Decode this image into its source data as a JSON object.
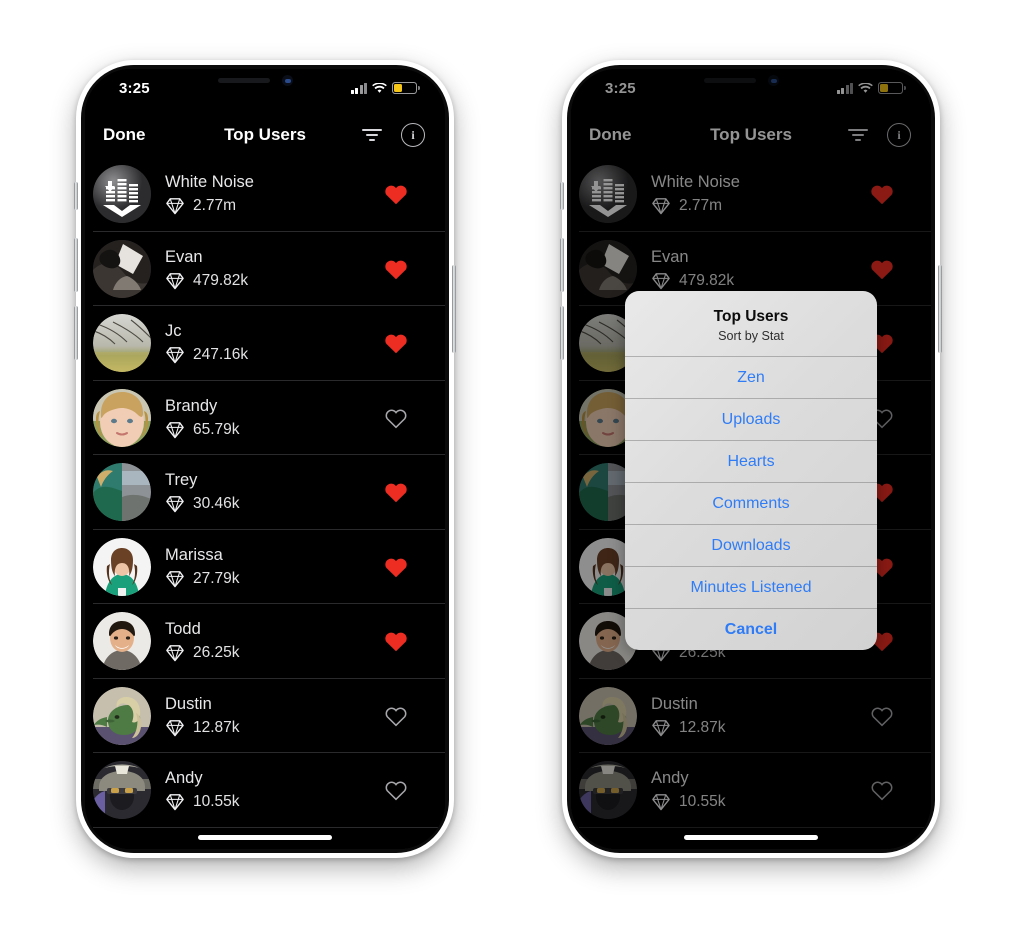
{
  "screens": [
    {
      "id": "list-screen",
      "status_bar": {
        "time": "3:25",
        "signal_icon": "cellular-signal-icon",
        "wifi_icon": "wifi-icon",
        "battery_icon": "battery-low-power-icon"
      },
      "nav": {
        "back_label": "Done",
        "title": "Top Users",
        "filter_icon": "sort-filter-icon",
        "info_icon": "info-circle-icon",
        "info_glyph": "i"
      },
      "sheet_visible": false
    },
    {
      "id": "sort-sheet-screen",
      "status_bar": {
        "time": "3:25",
        "signal_icon": "cellular-signal-icon",
        "wifi_icon": "wifi-icon",
        "battery_icon": "battery-low-power-icon"
      },
      "nav": {
        "back_label": "Done",
        "title": "Top Users",
        "filter_icon": "sort-filter-icon",
        "info_icon": "info-circle-icon",
        "info_glyph": "i"
      },
      "sheet_visible": true
    }
  ],
  "action_sheet": {
    "title": "Top Users",
    "subtitle": "Sort by Stat",
    "options": [
      {
        "label": "Zen"
      },
      {
        "label": "Uploads"
      },
      {
        "label": "Hearts"
      },
      {
        "label": "Comments"
      },
      {
        "label": "Downloads"
      },
      {
        "label": "Minutes Listened"
      }
    ],
    "cancel_label": "Cancel",
    "tint_color": "#2f7cf6"
  },
  "list": {
    "stat_icon": "gem-icon",
    "hearted_color": "#ee2d22",
    "unhearted_color": "#a8a8ac",
    "rows": [
      {
        "name": "White Noise",
        "value": "2.77m",
        "hearted": true,
        "avatar": "equalizer-logo-avatar"
      },
      {
        "name": "Evan",
        "value": "479.82k",
        "hearted": true,
        "avatar": "photo-avatar-evan"
      },
      {
        "name": "Jc",
        "value": "247.16k",
        "hearted": true,
        "avatar": "photo-avatar-jc"
      },
      {
        "name": "Brandy",
        "value": "65.79k",
        "hearted": false,
        "avatar": "photo-avatar-brandy"
      },
      {
        "name": "Trey",
        "value": "30.46k",
        "hearted": true,
        "avatar": "photo-avatar-trey"
      },
      {
        "name": "Marissa",
        "value": "27.79k",
        "hearted": true,
        "avatar": "photo-avatar-marissa"
      },
      {
        "name": "Todd",
        "value": "26.25k",
        "hearted": true,
        "avatar": "photo-avatar-todd"
      },
      {
        "name": "Dustin",
        "value": "12.87k",
        "hearted": false,
        "avatar": "illustration-avatar-dustin"
      },
      {
        "name": "Andy",
        "value": "10.55k",
        "hearted": false,
        "avatar": "photo-avatar-andy"
      }
    ]
  }
}
